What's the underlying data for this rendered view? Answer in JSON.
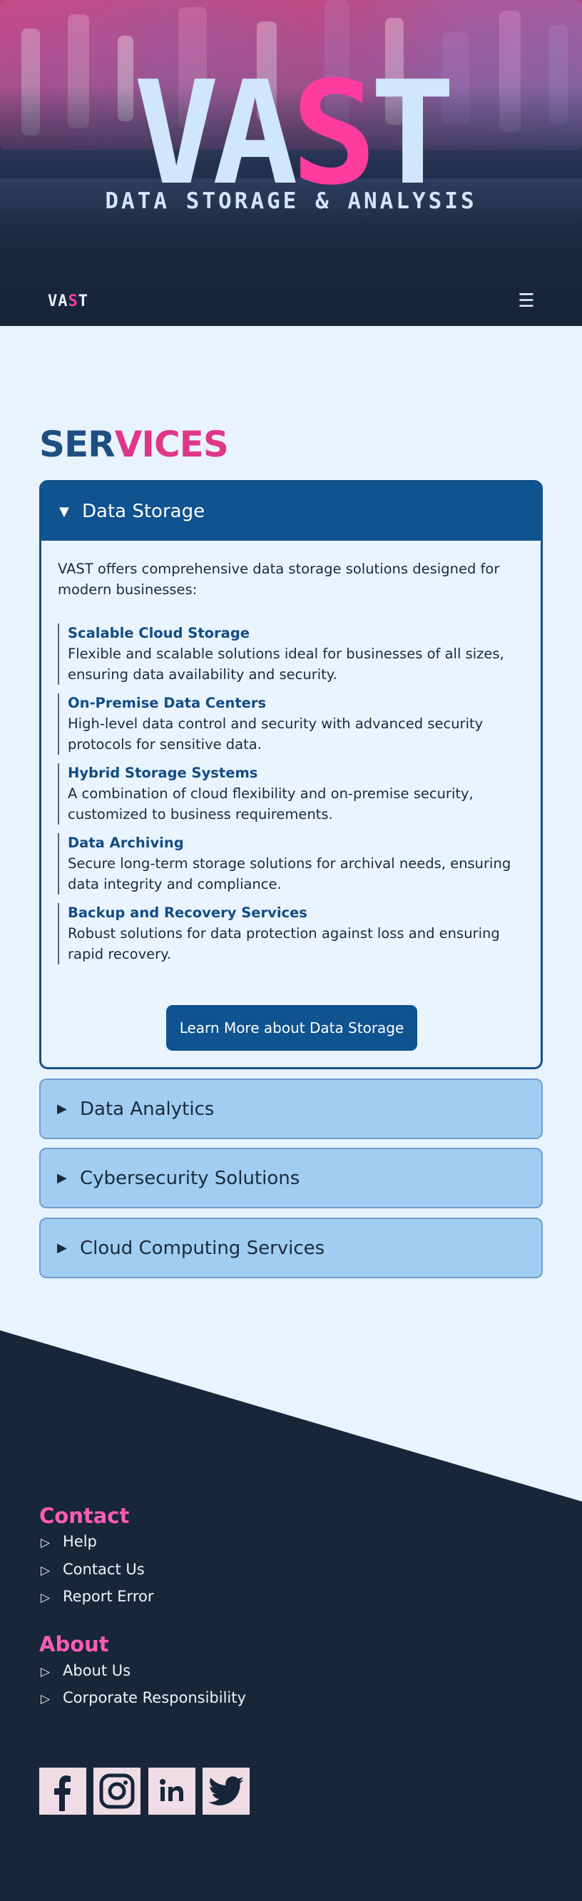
{
  "hero": {
    "logo_pre": "VA",
    "logo_accent": "S",
    "logo_post": "T",
    "tagline": "DATA STORAGE & ANALYSIS"
  },
  "nav": {
    "logo_pre": "VA",
    "logo_accent": "S",
    "logo_post": "T",
    "menu_icon": "hamburger-menu-icon",
    "menu_glyph": "☰"
  },
  "services": {
    "title_a": "SER",
    "title_b": "VICES",
    "open_panel": {
      "title": "Data Storage",
      "intro": "VAST offers comprehensive data storage solutions designed for modern businesses:",
      "items": [
        {
          "title": "Scalable Cloud Storage",
          "desc": "Flexible and scalable solutions ideal for businesses of all sizes, ensuring data availability and security."
        },
        {
          "title": "On-Premise Data Centers",
          "desc": "High-level data control and security with advanced security protocols for sensitive data."
        },
        {
          "title": "Hybrid Storage Systems",
          "desc": "A combination of cloud flexibility and on-premise security, customized to business requirements."
        },
        {
          "title": "Data Archiving",
          "desc": "Secure long-term storage solutions for archival needs, ensuring data integrity and compliance."
        },
        {
          "title": "Backup and Recovery Services",
          "desc": "Robust solutions for data protection against loss and ensuring rapid recovery."
        }
      ],
      "button": "Learn More about Data Storage"
    },
    "closed_panels": [
      {
        "title": "Data Analytics"
      },
      {
        "title": "Cybersecurity Solutions"
      },
      {
        "title": "Cloud Computing Services"
      }
    ]
  },
  "footer": {
    "contact": {
      "heading": "Contact",
      "links": [
        "Help",
        "Contact Us",
        "Report Error"
      ]
    },
    "about": {
      "heading": "About",
      "links": [
        "About Us",
        "Corporate Responsibility"
      ]
    },
    "social": [
      "facebook-icon",
      "instagram-icon",
      "linkedin-icon",
      "twitter-icon"
    ]
  },
  "colors": {
    "primary": "#0f5390",
    "accent": "#ff3c9e",
    "footer_bg": "#172639",
    "page_bg": "#e9f3fe",
    "panel_closed": "#a1cdf2"
  }
}
